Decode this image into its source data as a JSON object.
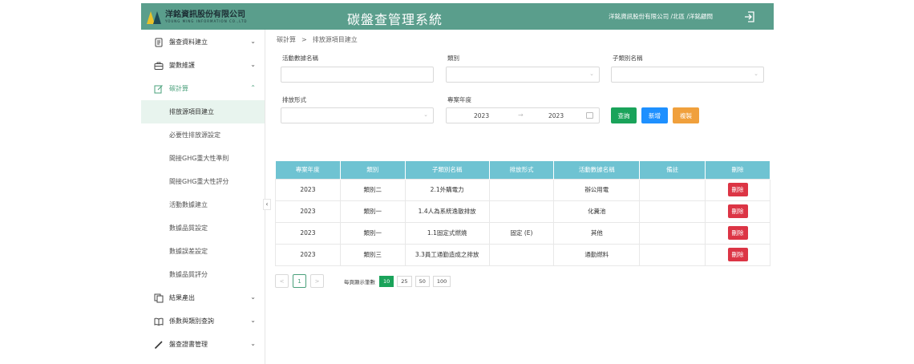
{
  "header": {
    "logo_text": "洋銘資訊股份有限公司",
    "logo_sub": "YOUNG MING INFORMATION CO.,LTD",
    "title": "碳盤查管理系統",
    "user_info": "洋銘資訊股份有限公司 /北區 /洋銘顧問"
  },
  "sidebar": {
    "groups": [
      {
        "label": "盤查資料建立",
        "icon": "document-icon"
      },
      {
        "label": "變數維護",
        "icon": "briefcase-icon"
      },
      {
        "label": "碳計算",
        "icon": "edit-icon"
      },
      {
        "label": "結果產出",
        "icon": "copy-icon"
      },
      {
        "label": "係數與類別查詢",
        "icon": "book-icon"
      },
      {
        "label": "盤查證書管理",
        "icon": "pen-icon"
      }
    ],
    "subitems": [
      "排放源項目建立",
      "必要性排放源設定",
      "間接GHG重大性準則",
      "間接GHG重大性評分",
      "活動數據建立",
      "數據品質設定",
      "數據誤差設定",
      "數據品質評分"
    ]
  },
  "breadcrumb": {
    "parent": "碳計算",
    "sep": ">",
    "current": "排放源項目建立"
  },
  "filters": {
    "activity_label": "活動數據名稱",
    "category_label": "類別",
    "subcategory_label": "子類別名稱",
    "emission_label": "排放形式",
    "year_label": "專案年度",
    "year_start": "2023",
    "year_end": "2023",
    "range_arrow": "→"
  },
  "buttons": {
    "query": "查詢",
    "add": "新增",
    "copy": "複製"
  },
  "colors": {
    "header": "#5a9e8c",
    "table_head": "#6fc3d2",
    "query": "#1aa35a",
    "add": "#1e90ff",
    "copy": "#f0a03c",
    "delete": "#dc3545"
  },
  "table": {
    "headers": [
      "專案年度",
      "類別",
      "子類別名稱",
      "排放形式",
      "活動數據名稱",
      "備註",
      "刪除"
    ],
    "rows": [
      {
        "year": "2023",
        "category": "類別二",
        "subcategory": "2.1外購電力",
        "emission": "",
        "activity": "辦公用電",
        "note": "",
        "delete": "刪除"
      },
      {
        "year": "2023",
        "category": "類別一",
        "subcategory": "1.4人為系統逸散排放",
        "emission": "",
        "activity": "化糞池",
        "note": "",
        "delete": "刪除"
      },
      {
        "year": "2023",
        "category": "類別一",
        "subcategory": "1.1固定式燃燒",
        "emission": "固定 (E)",
        "activity": "其他",
        "note": "",
        "delete": "刪除"
      },
      {
        "year": "2023",
        "category": "類別三",
        "subcategory": "3.3員工通勤造成之排放",
        "emission": "",
        "activity": "通勤燃料",
        "note": "",
        "delete": "刪除"
      }
    ]
  },
  "pagination": {
    "prev": "<",
    "current_page": "1",
    "next": ">",
    "page_size_label": "每頁顯示筆數",
    "page_sizes": [
      "10",
      "25",
      "50",
      "100"
    ]
  }
}
